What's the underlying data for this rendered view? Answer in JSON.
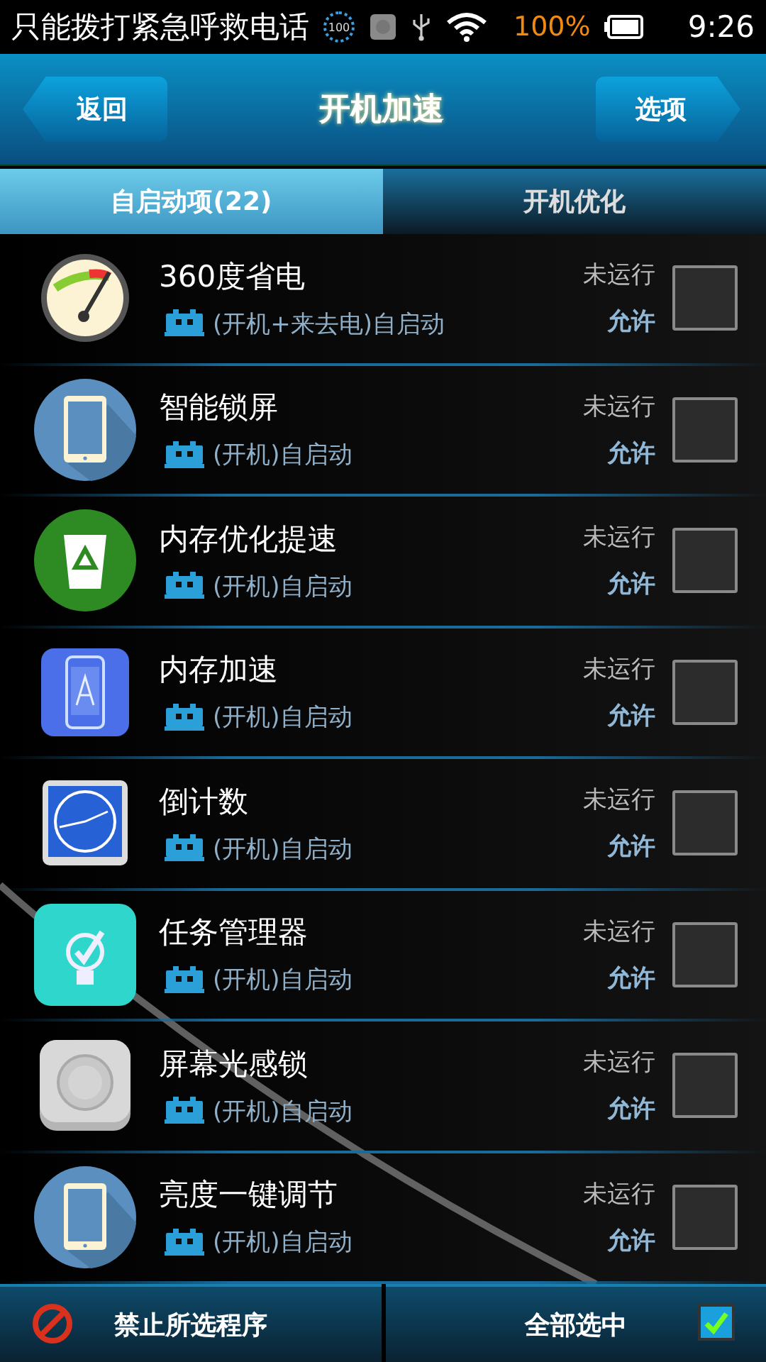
{
  "status_bar": {
    "carrier": "只能拨打紧急呼救电话",
    "badge": "100",
    "battery": "100%",
    "time": "9:26"
  },
  "header": {
    "back": "返回",
    "title": "开机加速",
    "options": "选项"
  },
  "tabs": [
    {
      "label": "自启动项(22)",
      "selected": true
    },
    {
      "label": "开机优化",
      "selected": false
    }
  ],
  "apps": [
    {
      "name": "360度省电",
      "trigger": "(开机+来去电)自启动",
      "status": "未运行",
      "permission": "允许",
      "checked": false,
      "kind": "gauge"
    },
    {
      "name": "智能锁屏",
      "trigger": "(开机)自启动",
      "status": "未运行",
      "permission": "允许",
      "checked": false,
      "kind": "tablet"
    },
    {
      "name": "内存优化提速",
      "trigger": "(开机)自启动",
      "status": "未运行",
      "permission": "允许",
      "checked": false,
      "kind": "recycle"
    },
    {
      "name": "内存加速",
      "trigger": "(开机)自启动",
      "status": "未运行",
      "permission": "允许",
      "checked": false,
      "kind": "phone"
    },
    {
      "name": "倒计数",
      "trigger": "(开机)自启动",
      "status": "未运行",
      "permission": "允许",
      "checked": false,
      "kind": "clock"
    },
    {
      "name": "任务管理器",
      "trigger": "(开机)自启动",
      "status": "未运行",
      "permission": "允许",
      "checked": false,
      "kind": "bulb"
    },
    {
      "name": "屏幕光感锁",
      "trigger": "(开机)自启动",
      "status": "未运行",
      "permission": "允许",
      "checked": false,
      "kind": "camera"
    },
    {
      "name": "亮度一键调节",
      "trigger": "(开机)自启动",
      "status": "未运行",
      "permission": "允许",
      "checked": false,
      "kind": "tablet"
    }
  ],
  "bottom_bar": {
    "forbid": "禁止所选程序",
    "select_all": "全部选中",
    "select_all_checked": true
  }
}
